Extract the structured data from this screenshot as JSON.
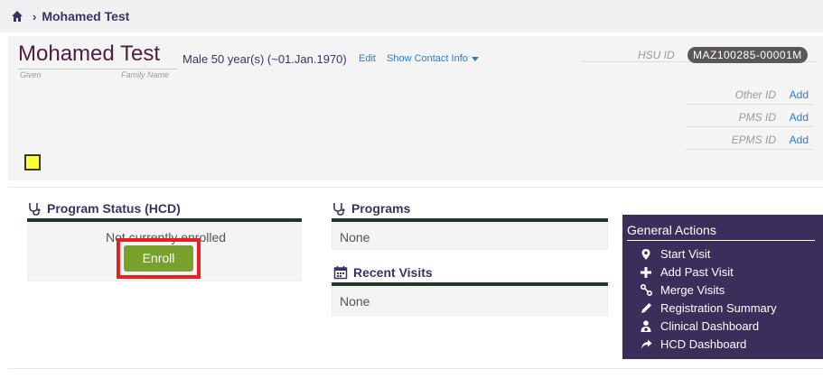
{
  "breadcrumb": {
    "home_icon": "home-icon",
    "separator": "›",
    "patient": "Mohamed Test"
  },
  "patient": {
    "given_name": "Mohamed",
    "family_name": "Test",
    "given_label": "Given",
    "family_label": "Family Name",
    "demographics": "Male  50 year(s) (~01.Jan.1970)",
    "edit_label": "Edit",
    "contact_label": "Show Contact Info",
    "hsu_label": "HSU ID",
    "hsu_value": "MAZ100285-00001M",
    "identifiers": [
      {
        "label": "Other ID",
        "action": "Add"
      },
      {
        "label": "PMS ID",
        "action": "Add"
      },
      {
        "label": "EPMS ID",
        "action": "Add"
      }
    ]
  },
  "program_status": {
    "title": "Program Status (HCD)",
    "status_text": "Not currently enrolled",
    "enroll_label": "Enroll"
  },
  "programs": {
    "title": "Programs",
    "value": "None"
  },
  "recent_visits": {
    "title": "Recent Visits",
    "value": "None"
  },
  "general_actions": {
    "title": "General Actions",
    "items": [
      {
        "label": "Start Visit",
        "icon": "location-pin-icon"
      },
      {
        "label": "Add Past Visit",
        "icon": "plus-icon"
      },
      {
        "label": "Merge Visits",
        "icon": "merge-icon"
      },
      {
        "label": "Registration Summary",
        "icon": "pencil-icon"
      },
      {
        "label": "Clinical Dashboard",
        "icon": "user-md-icon"
      },
      {
        "label": "HCD Dashboard",
        "icon": "share-arrow-icon"
      }
    ]
  },
  "colors": {
    "accent_dark_green": "#1f3a2b",
    "enroll_green": "#78a12d",
    "highlight_red": "#e82020",
    "actions_purple": "#3b2e5a",
    "link_blue": "#2f7cc4"
  }
}
